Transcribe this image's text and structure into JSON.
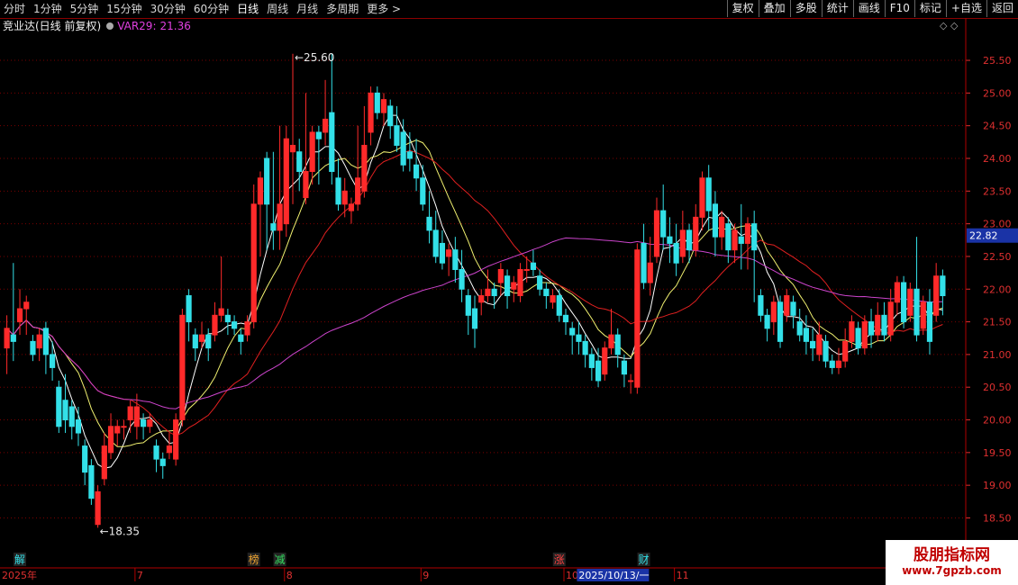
{
  "topbar": {
    "periods": [
      "分时",
      "1分钟",
      "5分钟",
      "15分钟",
      "30分钟",
      "60分钟",
      "日线",
      "周线",
      "月线",
      "多周期",
      "更多 >"
    ],
    "active_period": "日线",
    "tools": [
      "复权",
      "叠加",
      "多股",
      "统计",
      "画线",
      "F10",
      "标记",
      "+自选",
      "返回"
    ]
  },
  "info": {
    "stock_title": "竞业达(日线 前复权)",
    "indicator_name": "VAR29:",
    "indicator_value": "21.36",
    "corner_icons": "◇ ◇"
  },
  "colors": {
    "up": "#ff2a2a",
    "down": "#33e0e8",
    "grid": "#7a0000",
    "axis_text": "#e03030",
    "ma5": "#ffffff",
    "ma10": "#f0f070",
    "ma20": "#e02020",
    "ma60": "#cc44cc"
  },
  "chart_data": {
    "type": "candlestick",
    "y_ticks": [
      "25.50",
      "25.00",
      "24.50",
      "24.00",
      "23.50",
      "23.00",
      "22.50",
      "22.00",
      "21.50",
      "21.00",
      "20.50",
      "20.00",
      "19.50",
      "19.00",
      "18.50"
    ],
    "ylim": [
      18.3,
      25.9
    ],
    "current_price": "22.82",
    "high_marker": "25.60",
    "low_marker": "18.35",
    "date_axis": [
      {
        "label": "2025年",
        "index": 0
      },
      {
        "label": "7",
        "index": 20
      },
      {
        "label": "8",
        "index": 43
      },
      {
        "label": "9",
        "index": 64
      },
      {
        "label": "10",
        "index": 86
      },
      {
        "label": "2025/10/13/一",
        "index": 88
      },
      {
        "label": "11",
        "index": 103
      }
    ],
    "event_markers": [
      {
        "label": "解",
        "index": 2,
        "color": "#33e0e8"
      },
      {
        "label": "榜",
        "index": 38,
        "color": "#e8a030"
      },
      {
        "label": "减",
        "index": 42,
        "color": "#33e060"
      },
      {
        "label": "涨",
        "index": 85,
        "color": "#ff4040"
      },
      {
        "label": "财",
        "index": 98,
        "color": "#33e0e8"
      }
    ],
    "candles": [
      [
        21.1,
        21.4,
        21.6,
        20.7
      ],
      [
        21.3,
        21.2,
        22.4,
        20.9
      ],
      [
        21.5,
        21.7,
        22.0,
        21.3
      ],
      [
        21.7,
        21.8,
        21.9,
        21.3
      ],
      [
        21.2,
        21.0,
        21.3,
        20.9
      ],
      [
        21.1,
        21.3,
        21.4,
        20.9
      ],
      [
        21.4,
        21.0,
        21.5,
        20.7
      ],
      [
        21.0,
        20.8,
        21.2,
        20.6
      ],
      [
        20.5,
        19.9,
        20.6,
        19.8
      ],
      [
        20.3,
        20.0,
        20.7,
        19.8
      ],
      [
        20.2,
        19.9,
        20.3,
        19.7
      ],
      [
        20.0,
        19.8,
        20.2,
        19.6
      ],
      [
        19.6,
        19.2,
        19.7,
        19.0
      ],
      [
        19.3,
        18.8,
        19.4,
        18.7
      ],
      [
        18.4,
        18.9,
        19.0,
        18.35
      ],
      [
        19.1,
        19.6,
        19.8,
        19.0
      ],
      [
        19.5,
        19.9,
        20.1,
        19.4
      ],
      [
        19.8,
        19.9,
        20.0,
        19.6
      ],
      [
        19.9,
        19.9,
        20.0,
        19.7
      ],
      [
        20.0,
        20.2,
        20.3,
        19.8
      ],
      [
        19.9,
        20.2,
        20.4,
        19.7
      ],
      [
        20.0,
        19.9,
        20.1,
        19.7
      ],
      [
        19.9,
        20.0,
        20.1,
        19.8
      ],
      [
        19.6,
        19.4,
        19.7,
        19.2
      ],
      [
        19.4,
        19.3,
        19.5,
        19.1
      ],
      [
        19.5,
        19.6,
        19.8,
        19.4
      ],
      [
        19.4,
        20.0,
        20.1,
        19.3
      ],
      [
        20.0,
        21.6,
        21.7,
        19.9
      ],
      [
        21.9,
        21.5,
        22.0,
        21.2
      ],
      [
        21.3,
        21.1,
        21.4,
        20.9
      ],
      [
        21.2,
        21.3,
        21.5,
        21.1
      ],
      [
        21.3,
        21.1,
        21.4,
        20.9
      ],
      [
        21.3,
        21.6,
        21.8,
        21.2
      ],
      [
        21.6,
        21.7,
        22.5,
        21.5
      ],
      [
        21.6,
        21.5,
        21.7,
        21.3
      ],
      [
        21.5,
        21.4,
        21.6,
        21.3
      ],
      [
        21.3,
        21.2,
        21.4,
        21.0
      ],
      [
        21.3,
        21.5,
        21.6,
        21.2
      ],
      [
        21.5,
        23.3,
        23.6,
        21.4
      ],
      [
        23.3,
        23.7,
        23.8,
        22.5
      ],
      [
        24.0,
        23.3,
        24.1,
        22.6
      ],
      [
        23.0,
        22.9,
        24.1,
        22.6
      ],
      [
        22.9,
        23.3,
        24.5,
        22.6
      ],
      [
        23.0,
        24.3,
        24.5,
        22.8
      ],
      [
        24.1,
        24.2,
        25.6,
        23.3
      ],
      [
        24.1,
        23.8,
        24.3,
        23.5
      ],
      [
        23.4,
        23.8,
        25.0,
        23.3
      ],
      [
        23.8,
        24.4,
        24.5,
        23.6
      ],
      [
        24.4,
        24.3,
        24.5,
        23.6
      ],
      [
        24.4,
        24.6,
        25.2,
        24.2
      ],
      [
        24.7,
        23.8,
        25.6,
        23.6
      ],
      [
        23.7,
        23.3,
        24.0,
        23.2
      ],
      [
        23.3,
        23.5,
        23.7,
        23.1
      ],
      [
        23.2,
        23.3,
        23.4,
        23.0
      ],
      [
        23.3,
        23.7,
        24.5,
        23.2
      ],
      [
        23.5,
        24.2,
        24.8,
        23.4
      ],
      [
        24.4,
        25.0,
        25.1,
        24.2
      ],
      [
        25.0,
        24.7,
        25.1,
        24.6
      ],
      [
        24.7,
        24.9,
        25.0,
        24.5
      ],
      [
        24.8,
        24.5,
        24.9,
        24.3
      ],
      [
        24.5,
        24.2,
        24.8,
        24.1
      ],
      [
        24.4,
        23.9,
        24.6,
        23.8
      ],
      [
        24.1,
        24.0,
        24.4,
        23.8
      ],
      [
        23.9,
        23.7,
        24.3,
        23.5
      ],
      [
        23.7,
        23.3,
        23.9,
        23.2
      ],
      [
        23.1,
        22.9,
        23.5,
        22.7
      ],
      [
        22.9,
        22.5,
        23.2,
        22.4
      ],
      [
        22.7,
        22.4,
        22.9,
        22.3
      ],
      [
        22.5,
        22.6,
        22.7,
        22.2
      ],
      [
        22.6,
        22.3,
        22.8,
        22.1
      ],
      [
        22.3,
        22.0,
        22.6,
        21.8
      ],
      [
        21.9,
        21.6,
        22.0,
        21.3
      ],
      [
        21.7,
        21.4,
        21.9,
        21.1
      ],
      [
        21.8,
        21.9,
        22.0,
        21.6
      ],
      [
        21.9,
        22.0,
        22.3,
        21.8
      ],
      [
        22.0,
        21.9,
        22.1,
        21.7
      ],
      [
        22.1,
        22.3,
        22.4,
        21.9
      ],
      [
        22.2,
        21.9,
        22.3,
        21.7
      ],
      [
        22.0,
        22.1,
        22.2,
        21.8
      ],
      [
        21.9,
        22.3,
        22.4,
        21.8
      ],
      [
        22.3,
        22.3,
        22.5,
        22.1
      ],
      [
        22.4,
        22.3,
        22.6,
        22.2
      ],
      [
        22.2,
        22.0,
        22.3,
        21.9
      ],
      [
        22.0,
        21.9,
        22.1,
        21.7
      ],
      [
        21.8,
        21.9,
        22.0,
        21.7
      ],
      [
        21.9,
        21.6,
        22.0,
        21.5
      ],
      [
        21.6,
        21.5,
        21.7,
        21.3
      ],
      [
        21.4,
        21.3,
        21.5,
        21.0
      ],
      [
        21.3,
        21.2,
        21.5,
        21.0
      ],
      [
        21.2,
        21.0,
        21.3,
        20.8
      ],
      [
        21.0,
        20.8,
        21.1,
        20.6
      ],
      [
        20.9,
        20.6,
        21.1,
        20.5
      ],
      [
        20.7,
        21.1,
        21.2,
        20.6
      ],
      [
        21.1,
        21.3,
        21.7,
        21.0
      ],
      [
        21.3,
        21.0,
        21.4,
        20.8
      ],
      [
        20.9,
        20.7,
        21.0,
        20.5
      ],
      [
        20.6,
        20.6,
        20.7,
        20.4
      ],
      [
        20.5,
        22.6,
        22.7,
        20.4
      ],
      [
        22.7,
        22.1,
        23.0,
        22.0
      ],
      [
        22.1,
        22.4,
        22.8,
        21.9
      ],
      [
        22.5,
        23.2,
        23.4,
        22.4
      ],
      [
        23.2,
        22.8,
        23.6,
        22.6
      ],
      [
        22.8,
        22.7,
        23.1,
        22.4
      ],
      [
        22.7,
        22.4,
        23.0,
        22.2
      ],
      [
        22.5,
        22.9,
        23.2,
        22.4
      ],
      [
        22.9,
        22.6,
        23.0,
        22.4
      ],
      [
        22.6,
        23.1,
        23.3,
        22.5
      ],
      [
        23.1,
        23.7,
        23.8,
        22.9
      ],
      [
        23.7,
        23.2,
        23.9,
        22.9
      ],
      [
        23.3,
        22.8,
        23.5,
        22.5
      ],
      [
        22.8,
        23.1,
        23.2,
        22.6
      ],
      [
        23.0,
        22.6,
        23.1,
        22.4
      ],
      [
        22.6,
        22.9,
        23.0,
        22.4
      ],
      [
        22.8,
        22.7,
        23.3,
        22.3
      ],
      [
        22.7,
        23.0,
        23.1,
        22.3
      ],
      [
        23.0,
        22.6,
        23.2,
        21.8
      ],
      [
        21.9,
        21.6,
        22.0,
        21.5
      ],
      [
        21.6,
        21.4,
        21.7,
        21.2
      ],
      [
        21.5,
        21.8,
        21.9,
        21.3
      ],
      [
        21.8,
        21.2,
        21.9,
        21.1
      ],
      [
        21.6,
        21.9,
        22.0,
        21.5
      ],
      [
        21.8,
        21.6,
        21.9,
        21.4
      ],
      [
        21.5,
        21.3,
        21.7,
        21.2
      ],
      [
        21.4,
        21.2,
        21.6,
        21.0
      ],
      [
        21.2,
        21.1,
        21.4,
        20.9
      ],
      [
        21.0,
        21.3,
        21.5,
        20.9
      ],
      [
        21.2,
        20.9,
        21.3,
        20.8
      ],
      [
        20.9,
        20.8,
        21.0,
        20.7
      ],
      [
        20.8,
        20.9,
        21.1,
        20.7
      ],
      [
        20.9,
        21.2,
        21.4,
        20.8
      ],
      [
        21.2,
        21.5,
        21.6,
        21.1
      ],
      [
        21.4,
        21.1,
        21.5,
        21.0
      ],
      [
        21.1,
        21.5,
        21.6,
        21.0
      ],
      [
        21.5,
        21.3,
        21.7,
        21.1
      ],
      [
        21.3,
        21.6,
        21.8,
        21.2
      ],
      [
        21.6,
        21.3,
        21.8,
        21.2
      ],
      [
        21.3,
        21.8,
        22.0,
        21.2
      ],
      [
        21.8,
        22.1,
        22.2,
        21.6
      ],
      [
        22.1,
        21.5,
        22.2,
        21.4
      ],
      [
        21.6,
        22.0,
        22.1,
        21.5
      ],
      [
        22.0,
        21.3,
        22.8,
        21.2
      ],
      [
        21.4,
        21.8,
        21.9,
        21.3
      ],
      [
        21.8,
        21.2,
        22.0,
        21.0
      ],
      [
        21.6,
        22.2,
        22.4,
        21.5
      ],
      [
        22.2,
        21.9,
        22.3,
        21.6
      ]
    ]
  },
  "watermark": {
    "line1": "股朋指标网",
    "line2": "www.7gpzb.com"
  }
}
